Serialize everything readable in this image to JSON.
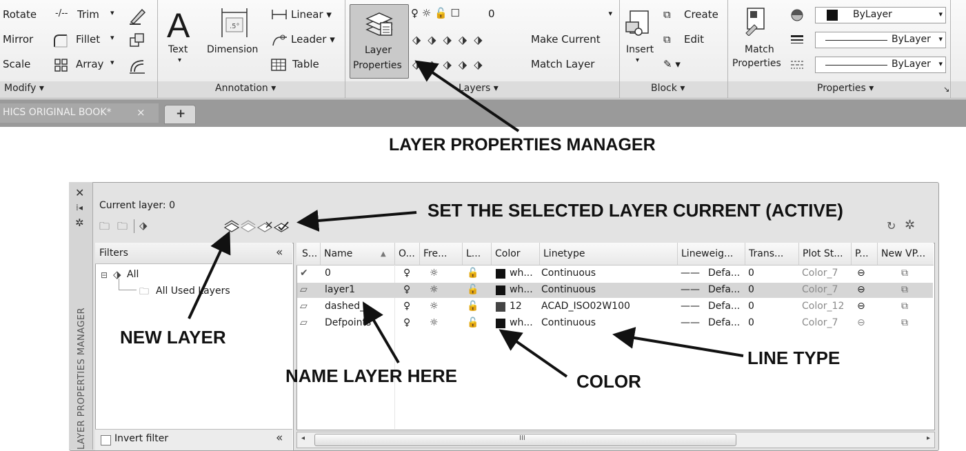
{
  "ribbon": {
    "modify": {
      "rotate": "Rotate",
      "mirror": "Mirror",
      "scale": "Scale",
      "trim": "Trim",
      "fillet": "Fillet",
      "array": "Array",
      "panel_label": "Modify ▾"
    },
    "annotation": {
      "text": "Text",
      "dimension": "Dimension",
      "linear": "Linear ▾",
      "leader": "Leader ▾",
      "table": "Table",
      "panel_label": "Annotation ▾"
    },
    "layers": {
      "layer_properties_line1": "Layer",
      "layer_properties_line2": "Properties",
      "current_layer_value": "0",
      "make_current": "Make Current",
      "match_layer": "Match Layer",
      "panel_label": "Layers ▾"
    },
    "block": {
      "insert": "Insert",
      "create": "Create",
      "edit": "Edit",
      "panel_label": "Block ▾"
    },
    "properties": {
      "match_line1": "Match",
      "match_line2": "Properties",
      "color_value": "ByLayer",
      "linetype_value": "ByLayer",
      "lineweight_value": "ByLayer",
      "panel_label": "Properties ▾"
    }
  },
  "filetab": {
    "title": "HICS ORIGINAL BOOK*",
    "close": "×",
    "new": "+"
  },
  "callouts": {
    "manager": "LAYER PROPERTIES MANAGER",
    "set_current": "SET THE SELECTED LAYER CURRENT (ACTIVE)",
    "new_layer": "NEW LAYER",
    "name_layer": "NAME LAYER HERE",
    "color": "COLOR",
    "line_type": "LINE TYPE"
  },
  "manager": {
    "side_title": "LAYER PROPERTIES MANAGER",
    "current_layer": "Current layer: 0",
    "filters_header": "Filters",
    "collapse": "«",
    "tree_all": "All",
    "tree_used": "All Used Layers",
    "invert_filter": "Invert filter",
    "scroll_mid": "III",
    "columns": [
      "S...",
      "Name",
      "O...",
      "Fre...",
      "L...",
      "Color",
      "Linetype",
      "Lineweig...",
      "Trans...",
      "Plot St...",
      "P...",
      "New VP..."
    ],
    "layers": [
      {
        "name": "0",
        "color_name": "wh...",
        "color_hex": "#111111",
        "linetype": "Continuous",
        "lineweight": "Defa...",
        "transparency": "0",
        "plot_style": "Color_7"
      },
      {
        "name": "layer1",
        "color_name": "wh...",
        "color_hex": "#111111",
        "linetype": "Continuous",
        "lineweight": "Defa...",
        "transparency": "0",
        "plot_style": "Color_7"
      },
      {
        "name": "dashed_",
        "color_name": "12",
        "color_hex": "#444444",
        "linetype": "ACAD_ISO02W100",
        "lineweight": "Defa...",
        "transparency": "0",
        "plot_style": "Color_12"
      },
      {
        "name": "Defpoints",
        "color_name": "wh...",
        "color_hex": "#111111",
        "linetype": "Continuous",
        "lineweight": "Defa...",
        "transparency": "0",
        "plot_style": "Color_7"
      }
    ]
  }
}
